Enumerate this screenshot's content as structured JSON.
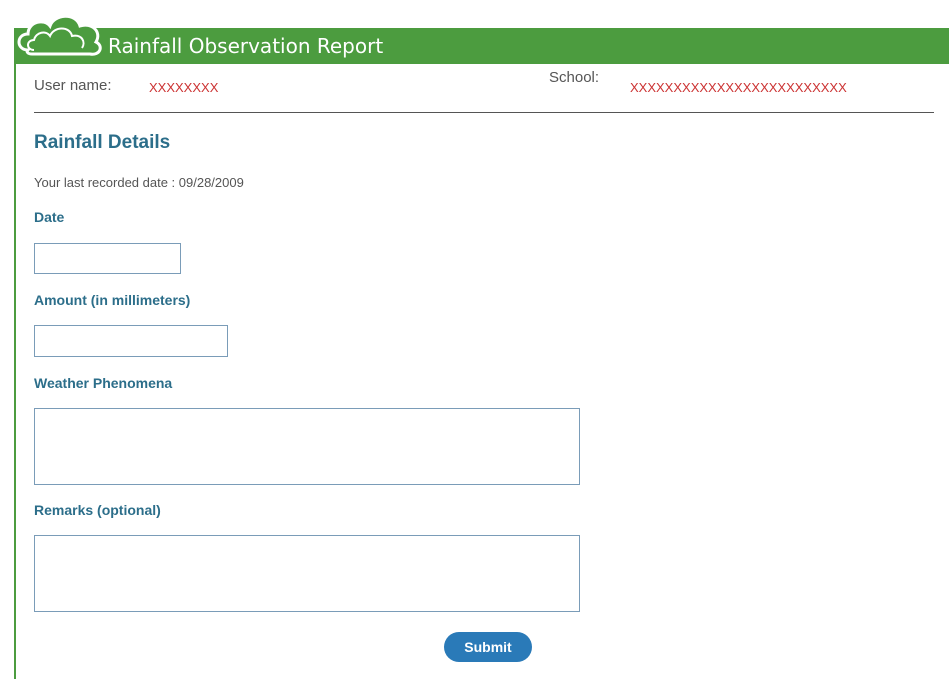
{
  "header": {
    "title": "Rainfall Observation Report"
  },
  "user_info": {
    "user_label": "User name:",
    "user_value": "XXXXXXXX",
    "school_label": "School:",
    "school_value": "XXXXXXXXXXXXXXXXXXXXXXXXX"
  },
  "form": {
    "section_title": "Rainfall Details",
    "last_recorded": "Your last recorded date : 09/28/2009",
    "date_label": "Date",
    "date_value": "",
    "amount_label": "Amount (in millimeters)",
    "amount_value": "",
    "weather_label": "Weather Phenomena",
    "weather_value": "",
    "remarks_label": "Remarks (optional)",
    "remarks_value": "",
    "submit_label": "Submit"
  },
  "colors": {
    "header_green": "#4c9c3f",
    "label_blue": "#2c6e8a",
    "placeholder_red": "#cc3333",
    "button_blue": "#2a7ab8"
  },
  "icons": {
    "logo": "cloud-icon"
  }
}
